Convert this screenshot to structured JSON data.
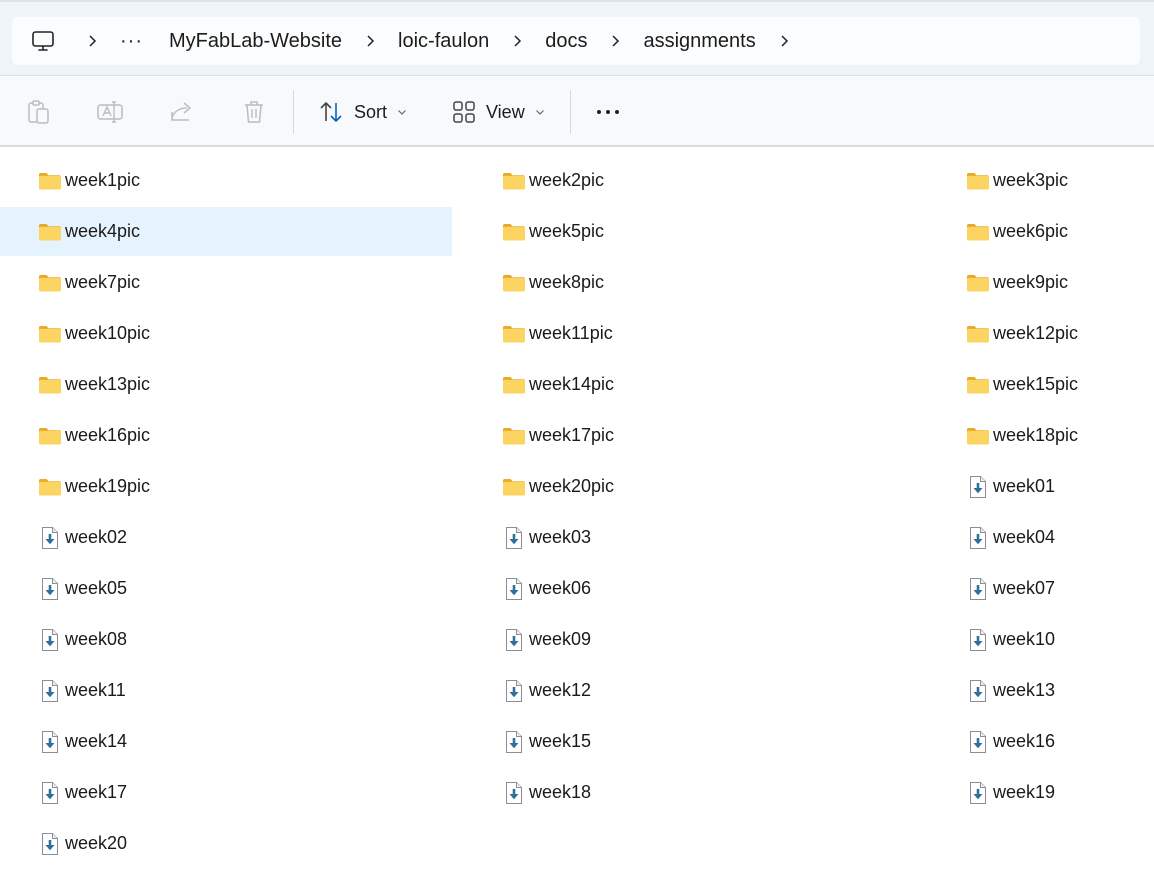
{
  "breadcrumb": {
    "more_label": "···",
    "items": [
      "MyFabLab-Website",
      "loic-faulon",
      "docs",
      "assignments"
    ]
  },
  "toolbar": {
    "sort_label": "Sort",
    "view_label": "View",
    "more_label": "···"
  },
  "colors": {
    "accent": "#0067c0",
    "selection": "#e5f3fe",
    "folder": "#f8c845"
  },
  "files": [
    {
      "name": "week1pic",
      "type": "folder"
    },
    {
      "name": "week2pic",
      "type": "folder"
    },
    {
      "name": "week3pic",
      "type": "folder"
    },
    {
      "name": "week4pic",
      "type": "folder",
      "selected": true
    },
    {
      "name": "week5pic",
      "type": "folder"
    },
    {
      "name": "week6pic",
      "type": "folder"
    },
    {
      "name": "week7pic",
      "type": "folder"
    },
    {
      "name": "week8pic",
      "type": "folder"
    },
    {
      "name": "week9pic",
      "type": "folder"
    },
    {
      "name": "week10pic",
      "type": "folder"
    },
    {
      "name": "week11pic",
      "type": "folder"
    },
    {
      "name": "week12pic",
      "type": "folder"
    },
    {
      "name": "week13pic",
      "type": "folder"
    },
    {
      "name": "week14pic",
      "type": "folder"
    },
    {
      "name": "week15pic",
      "type": "folder"
    },
    {
      "name": "week16pic",
      "type": "folder"
    },
    {
      "name": "week17pic",
      "type": "folder"
    },
    {
      "name": "week18pic",
      "type": "folder"
    },
    {
      "name": "week19pic",
      "type": "folder"
    },
    {
      "name": "week20pic",
      "type": "folder"
    },
    {
      "name": "week01",
      "type": "file"
    },
    {
      "name": "week02",
      "type": "file"
    },
    {
      "name": "week03",
      "type": "file"
    },
    {
      "name": "week04",
      "type": "file"
    },
    {
      "name": "week05",
      "type": "file"
    },
    {
      "name": "week06",
      "type": "file"
    },
    {
      "name": "week07",
      "type": "file"
    },
    {
      "name": "week08",
      "type": "file"
    },
    {
      "name": "week09",
      "type": "file"
    },
    {
      "name": "week10",
      "type": "file"
    },
    {
      "name": "week11",
      "type": "file"
    },
    {
      "name": "week12",
      "type": "file"
    },
    {
      "name": "week13",
      "type": "file"
    },
    {
      "name": "week14",
      "type": "file"
    },
    {
      "name": "week15",
      "type": "file"
    },
    {
      "name": "week16",
      "type": "file"
    },
    {
      "name": "week17",
      "type": "file"
    },
    {
      "name": "week18",
      "type": "file"
    },
    {
      "name": "week19",
      "type": "file"
    },
    {
      "name": "week20",
      "type": "file"
    }
  ]
}
